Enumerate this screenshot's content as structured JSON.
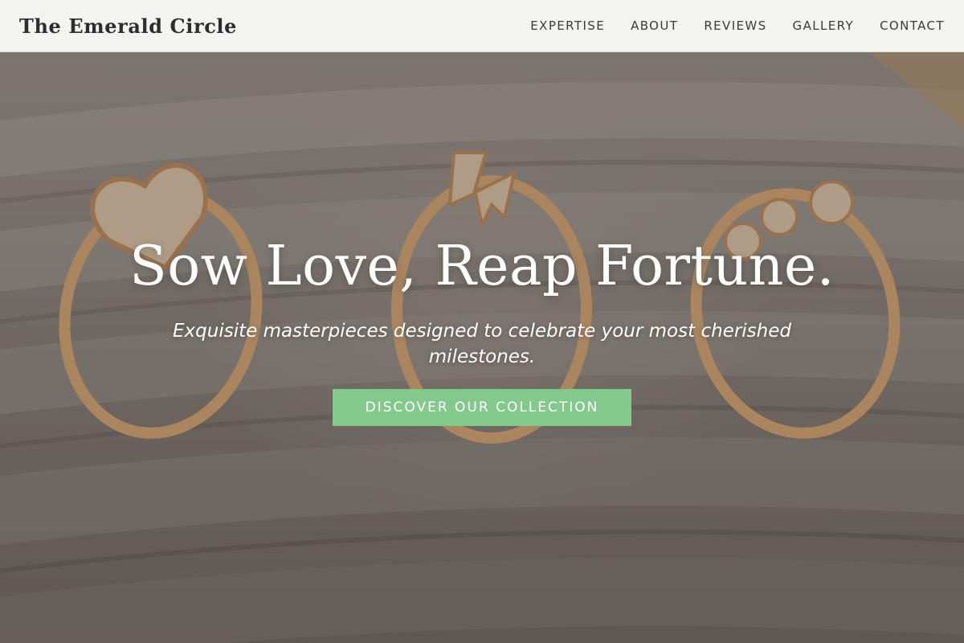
{
  "brand": {
    "name": "The Emerald Circle"
  },
  "nav": {
    "items": [
      {
        "label": "EXPERTISE"
      },
      {
        "label": "ABOUT"
      },
      {
        "label": "REVIEWS"
      },
      {
        "label": "GALLERY"
      },
      {
        "label": "CONTACT"
      }
    ]
  },
  "hero": {
    "headline": "Sow Love, Reap Fortune.",
    "subhead": "Exquisite masterpieces designed to celebrate your most cherished milestones.",
    "cta_label": "DISCOVER OUR COLLECTION",
    "background_image": "rings-display-photo"
  },
  "colors": {
    "nav_bg": "#f3f3f2",
    "brand_text": "#2d2d2d",
    "cta_bg": "#82c98b",
    "hero_text": "#ffffff"
  }
}
